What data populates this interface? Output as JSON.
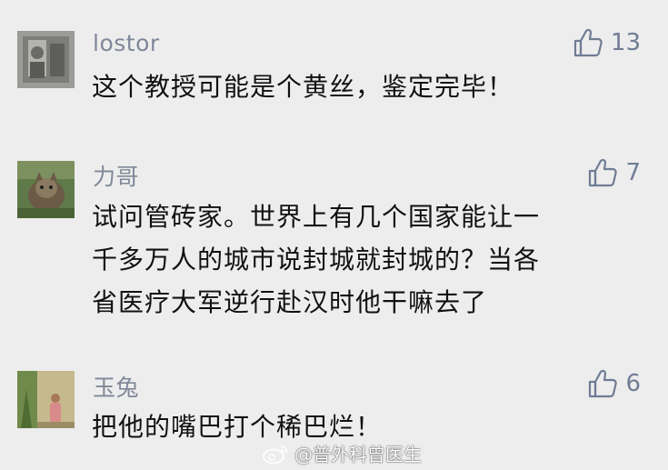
{
  "comments": [
    {
      "username": "lostor",
      "likes": "13",
      "text_lines": [
        "这个教授可能是个黄丝，鉴定完毕！"
      ],
      "avatar_icon": "avatar-gray-portrait"
    },
    {
      "username": "力哥",
      "likes": "7",
      "text_lines": [
        "试问管砖家。世界上有几个国家能让一",
        "千多万人的城市说封城就封城的？当各",
        "省医疗大军逆行赴汉时他干嘛去了"
      ],
      "avatar_icon": "avatar-cat-photo"
    },
    {
      "username": "玉兔",
      "likes": "6",
      "text_lines": [
        "把他的嘴巴打个稀巴烂！"
      ],
      "avatar_icon": "avatar-person-garden"
    }
  ],
  "watermark": {
    "text": "@普外科曾医生",
    "icon": "weibo-logo-icon"
  },
  "colors": {
    "background": "#ededed",
    "username": "#7f8898",
    "like": "#6f7c94",
    "text": "#111111"
  }
}
